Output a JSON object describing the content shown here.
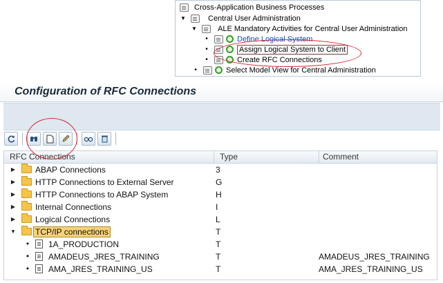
{
  "img_tree": {
    "items": [
      {
        "text": "Cross-Application Business Processes",
        "style": "plain"
      },
      {
        "text": "Central User Administration",
        "style": "plain"
      },
      {
        "text": "ALE Mandatory Activities for Central User Administration",
        "style": "plain"
      },
      {
        "text": "Define Logical System",
        "style": "link"
      },
      {
        "text": "Assign Logical System to Client",
        "style": "boxed"
      },
      {
        "text": "Create RFC Connections",
        "style": "plain"
      },
      {
        "text": "Select Model View for Central Administration",
        "style": "plain"
      }
    ]
  },
  "window": {
    "title": "Configuration of RFC Connections"
  },
  "toolbar": {
    "buttons": [
      {
        "name": "refresh-icon",
        "glyph": "⟳"
      },
      {
        "name": "find-icon",
        "glyph": "⌕"
      },
      {
        "name": "create-icon",
        "glyph": "▯"
      },
      {
        "name": "edit-icon",
        "glyph": "✎"
      },
      {
        "name": "display-icon",
        "glyph": "👓"
      },
      {
        "name": "delete-icon",
        "glyph": "🗑"
      }
    ]
  },
  "table": {
    "columns": [
      "RFC Connections",
      "Type",
      "Comment"
    ],
    "rows": [
      {
        "kind": "folder",
        "expanded": false,
        "name": "ABAP Connections",
        "type": "3",
        "comment": ""
      },
      {
        "kind": "folder",
        "expanded": false,
        "name": "HTTP Connections to External Server",
        "type": "G",
        "comment": ""
      },
      {
        "kind": "folder",
        "expanded": false,
        "name": "HTTP Connections to ABAP System",
        "type": "H",
        "comment": ""
      },
      {
        "kind": "folder",
        "expanded": false,
        "name": "Internal Connections",
        "type": "I",
        "comment": ""
      },
      {
        "kind": "folder",
        "expanded": false,
        "name": "Logical Connections",
        "type": "L",
        "comment": ""
      },
      {
        "kind": "folder",
        "expanded": true,
        "name": "TCP/IP connections",
        "type": "T",
        "comment": "",
        "selected": true
      },
      {
        "kind": "file",
        "name": "1A_PRODUCTION",
        "type": "T",
        "comment": ""
      },
      {
        "kind": "file",
        "name": "AMADEUS_JRES_TRAINING",
        "type": "T",
        "comment": "AMADEUS_JRES_TRAINING"
      },
      {
        "kind": "file",
        "name": "AMA_JRES_TRAINING_US",
        "type": "T",
        "comment": "AMA_JRES_TRAINING_US"
      }
    ]
  },
  "colors": {
    "annotation": "#d9262e",
    "folder": "#f5c44a",
    "link": "#0b50c4",
    "selected": "#f7d27a"
  }
}
